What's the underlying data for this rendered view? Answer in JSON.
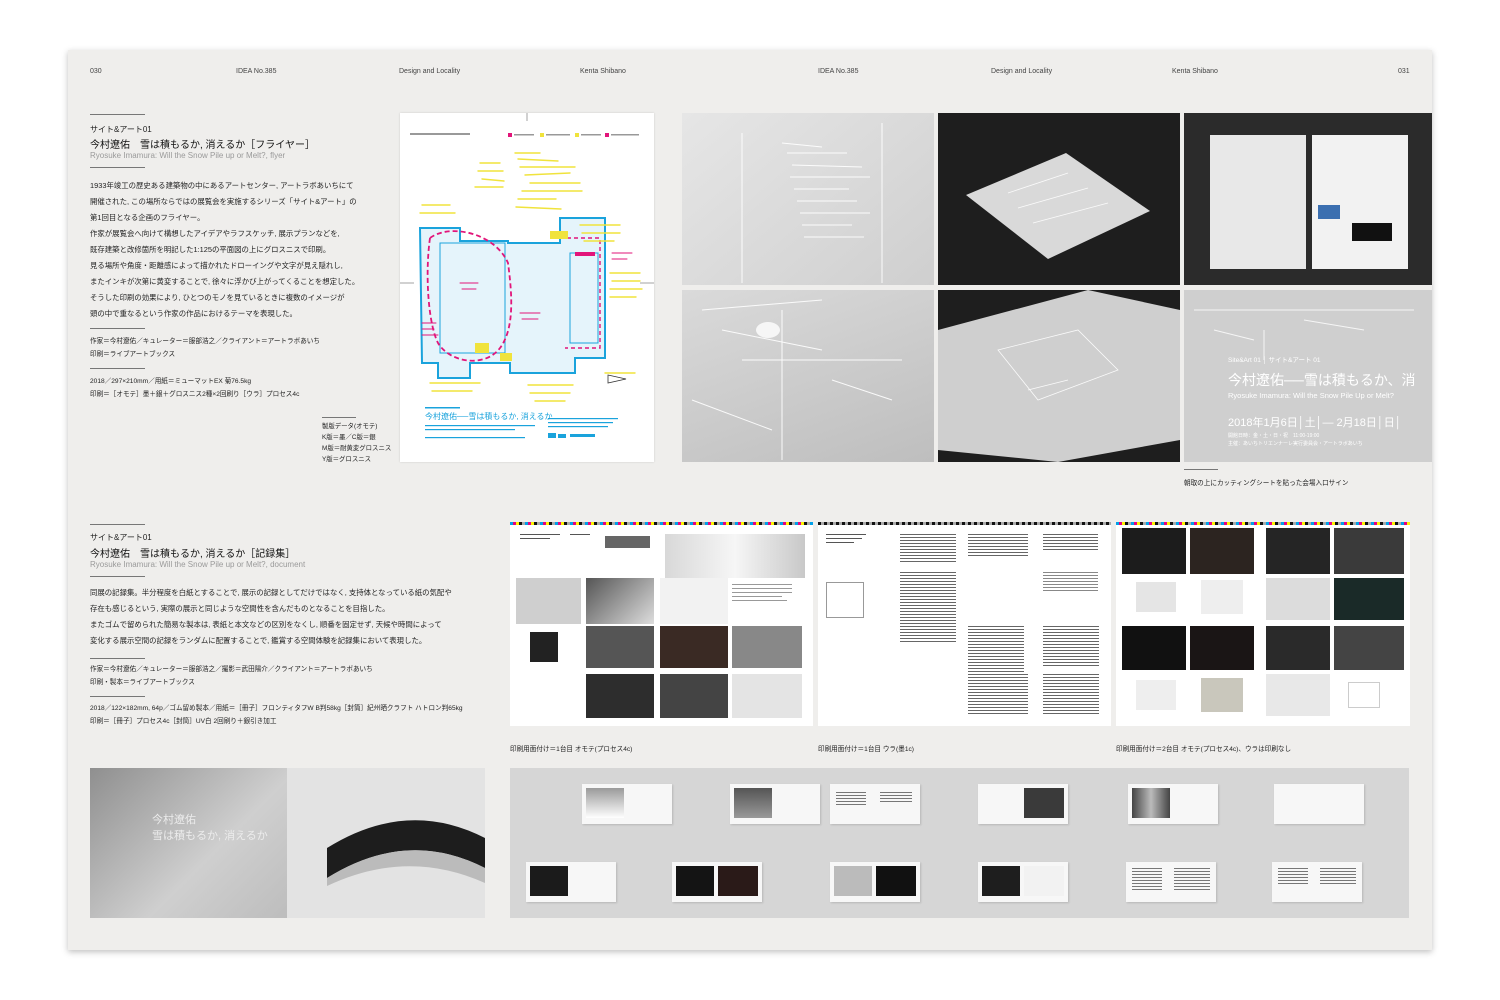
{
  "header_left": {
    "page": "030",
    "magazine": "IDEA No.385",
    "series": "Design and Locality",
    "author": "Kenta Shibano"
  },
  "header_right": {
    "magazine": "IDEA No.385",
    "series": "Design and Locality",
    "author": "Kenta Shibano",
    "page": "031"
  },
  "section1": {
    "label": "サイト&アート01",
    "title": "今村遼佑　雪は積もるか, 消えるか［フライヤー］",
    "subtitle": "Ryosuke Imamura: Will the Snow Pile up or Melt?, flyer",
    "body": "1933年竣工の歴史ある建築物の中にあるアートセンター, アートラボあいちにて\n開催された, この場所ならではの展覧会を実施するシリーズ「サイト&アート」の\n第1回目となる企画のフライヤー。\n作家が展覧会へ向けて構想したアイデアやラフスケッチ, 展示プランなどを,\n既存建築と改修箇所を明記した1:125の平面図の上にグロスニスで印刷。\n見る場所や角度・距離感によって描かれたドローイングや文字が見え隠れし,\nまたインキが次第に黄変することで, 徐々に浮かび上がってくることを想定した。\nそうした印刷の効果により, ひとつのモノを見ているときに複数のイメージが\n頭の中で重なるという作家の作品におけるテーマを表現した。",
    "credits": "作家＝今村遼佑／キュレーター＝服部浩之／クライアント＝アートラボあいち\n印刷＝ライブアートブックス",
    "specs": "2018／297×210mm／用紙＝ミューマットEX 菊76.5kg\n印刷＝［オモテ］墨＋銀＋グロスニス2種×2回刷り［ウラ］プロセス4c",
    "plate_note": "製版データ(オモテ)\nK版＝墨／C版＝銀\nM版＝耐黄変グロスニス\nY版＝グロスニス",
    "photo_caption": "朝取の上にカッティングシートを貼った会場入口サイン",
    "flyer_title": "今村遼佑──雪は積もるか, 消えるか",
    "sign": {
      "label": "Site&Art 01 │ サイト&アート 01",
      "title": "今村遼佑──雪は積もるか、消",
      "subtitle": "Ryosuke Imamura: Will the Snow Pile Up or Melt?",
      "date": "2018年1月6日│土│— 2月18日│日│",
      "hours": "開館日時：金・土・日・祝　11:00-19:00",
      "organizer": "主催：あいちトリエンナーレ実行委員会・アートラボあいち"
    }
  },
  "section2": {
    "label": "サイト&アート01",
    "title": "今村遼佑　雪は積もるか, 消えるか［記録集］",
    "subtitle": "Ryosuke Imamura: Will the Snow Pile up or Melt?, document",
    "body": "同展の記録集。半分程度を白紙とすることで, 展示の記録としてだけではなく, 支持体となっている紙の気配や\n存在も感じるという, 実際の展示と同じような空間性を含んだものとなることを目指した。\nまたゴムで留められた簡易な製本は, 表紙と本文などの区別をなくし, 順番を固定せず, 天候や時間によって\n変化する展示空間の記録をランダムに配置することで, 鑑賞する空間体験を記録集において表現した。",
    "credits": "作家＝今村遼佑／キュレーター＝服部浩之／撮影＝武田陽介／クライアント＝アートラボあいち\n印刷・製本＝ライブアートブックス",
    "specs": "2018／122×182mm, 64p／ゴム留め製本／用紙＝［冊子］フロンティタフW B判58kg［封筒］紀州晒クラフト ハトロン判65kg\n印刷＝［冊子］プロセス4c［封筒］UV白 2回刷り＋銀引き加工",
    "sheet_captions": [
      "印刷用面付け＝1台目 オモテ(プロセス4c)",
      "印刷用面付け＝1台目 ウラ(墨1c)",
      "印刷用面付け＝2台目 オモテ(プロセス4c)、ウラは印刷なし"
    ],
    "cover_text": "今村遼佑\n雪は積もるか, 消えるか"
  },
  "colors": {
    "spread_bg": "#efeeec",
    "flyer_cyan": "#1aa3dc",
    "flyer_magenta": "#e2157a",
    "flyer_yellow": "#f0e33c",
    "dark_photo": "#222222"
  }
}
